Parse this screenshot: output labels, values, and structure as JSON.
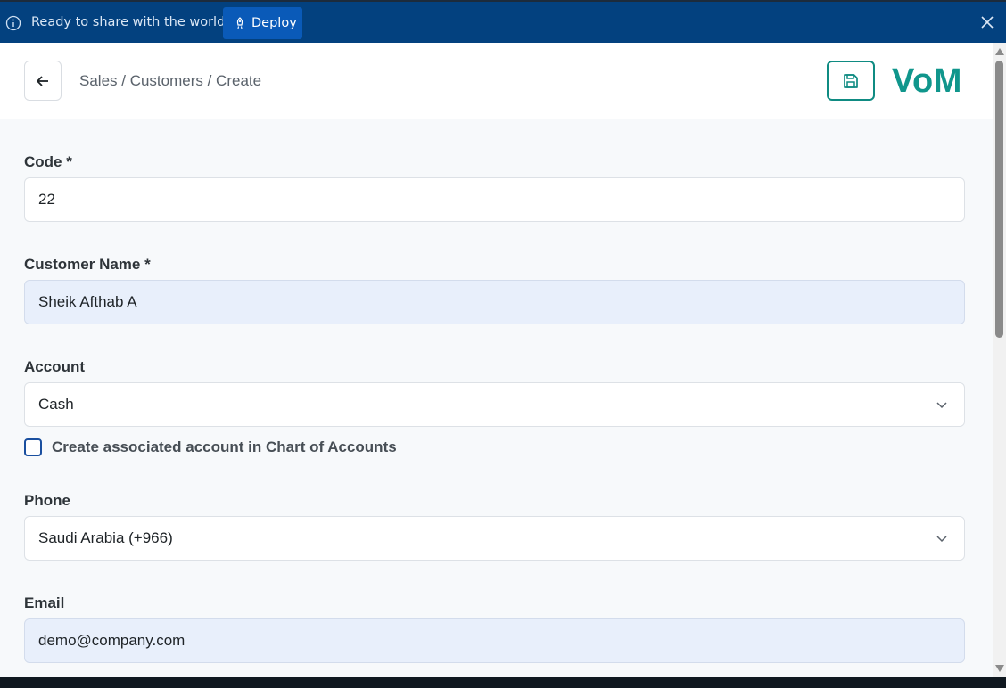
{
  "banner": {
    "message": "Ready to share with the world?",
    "deploy_label": "Deploy",
    "icons": [
      "info-icon",
      "rocket-icon",
      "close-icon"
    ]
  },
  "header": {
    "breadcrumb": "Sales / Customers / Create",
    "logo": "VoM",
    "icons": [
      "arrow-left-icon",
      "save-icon"
    ]
  },
  "form": {
    "code": {
      "label": "Code *",
      "value": "22"
    },
    "customer_name": {
      "label": "Customer Name *",
      "value": "Sheik Afthab A"
    },
    "account": {
      "label": "Account",
      "value": "Cash"
    },
    "create_account_checkbox": {
      "label": "Create associated account in Chart of Accounts",
      "checked": false
    },
    "phone": {
      "label": "Phone",
      "value": "Saudi Arabia (+966)"
    },
    "email": {
      "label": "Email",
      "value": "demo@company.com"
    }
  },
  "colors": {
    "banner_bg": "#03417f",
    "deploy_button": "#0a5ab8",
    "brand_teal": "#10968c",
    "autofill_bg": "#e8effb"
  }
}
